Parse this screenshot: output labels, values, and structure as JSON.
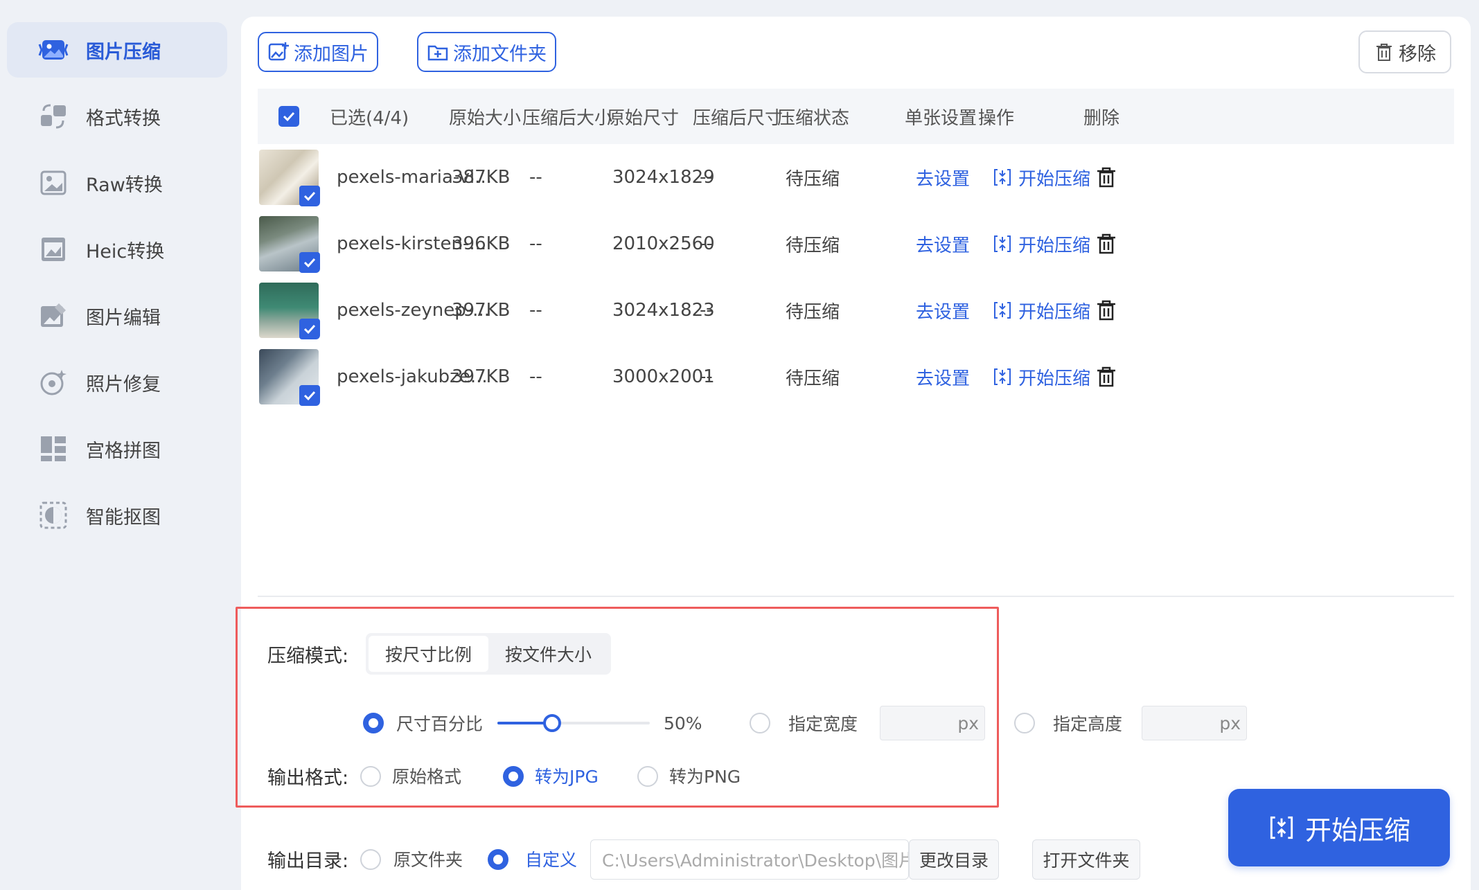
{
  "sidebar": {
    "items": [
      {
        "label": "图片压缩",
        "icon": "image-compress-icon",
        "active": true
      },
      {
        "label": "格式转换",
        "icon": "format-convert-icon"
      },
      {
        "label": "Raw转换",
        "icon": "raw-convert-icon"
      },
      {
        "label": "Heic转换",
        "icon": "heic-convert-icon"
      },
      {
        "label": "图片编辑",
        "icon": "image-edit-icon"
      },
      {
        "label": "照片修复",
        "icon": "photo-repair-icon"
      },
      {
        "label": "宫格拼图",
        "icon": "grid-collage-icon"
      },
      {
        "label": "智能抠图",
        "icon": "smart-cutout-icon"
      }
    ]
  },
  "toolbar": {
    "add_image": "添加图片",
    "add_folder": "添加文件夹",
    "remove": "移除"
  },
  "table": {
    "headers": {
      "selected": "已选(4/4)",
      "orig_size": "原始大小",
      "comp_size": "压缩后大小",
      "orig_dim": "原始尺寸",
      "comp_dim": "压缩后尺寸",
      "status": "压缩状态",
      "single": "单张设置",
      "ops": "操作",
      "delete": "删除"
    },
    "rows": [
      {
        "name": "pexels-maria-vi...",
        "orig_size": "387KB",
        "comp_size": "--",
        "orig_dim": "3024x1829",
        "comp_dim": "--",
        "status": "待压缩",
        "setting": "去设置",
        "op": "开始压缩"
      },
      {
        "name": "pexels-kirsten-...",
        "orig_size": "396KB",
        "comp_size": "--",
        "orig_dim": "2010x2560",
        "comp_dim": "--",
        "status": "待压缩",
        "setting": "去设置",
        "op": "开始压缩"
      },
      {
        "name": "pexels-zeynep-...",
        "orig_size": "397KB",
        "comp_size": "--",
        "orig_dim": "3024x1823",
        "comp_dim": "--",
        "status": "待压缩",
        "setting": "去设置",
        "op": "开始压缩"
      },
      {
        "name": "pexels-jakubze...",
        "orig_size": "397KB",
        "comp_size": "--",
        "orig_dim": "3000x2001",
        "comp_dim": "--",
        "status": "待压缩",
        "setting": "去设置",
        "op": "开始压缩"
      }
    ]
  },
  "settings": {
    "mode_label": "压缩模式:",
    "mode_by_ratio": "按尺寸比例",
    "mode_by_size": "按文件大小",
    "percent_label": "尺寸百分比",
    "percent_value": "50%",
    "percent_fraction": 0.5,
    "width_label": "指定宽度",
    "height_label": "指定高度",
    "px_unit": "px",
    "format_label": "输出格式:",
    "format_original": "原始格式",
    "format_jpg": "转为JPG",
    "format_png": "转为PNG",
    "output_label": "输出目录:",
    "output_original": "原文件夹",
    "output_custom": "自定义",
    "output_path": "C:\\Users\\Administrator\\Desktop\\图片",
    "change_dir": "更改目录",
    "open_folder": "打开文件夹"
  },
  "actions": {
    "start": "开始压缩"
  },
  "colors": {
    "accent": "#2f62e0",
    "highlight_box": "#ee5c5c"
  }
}
